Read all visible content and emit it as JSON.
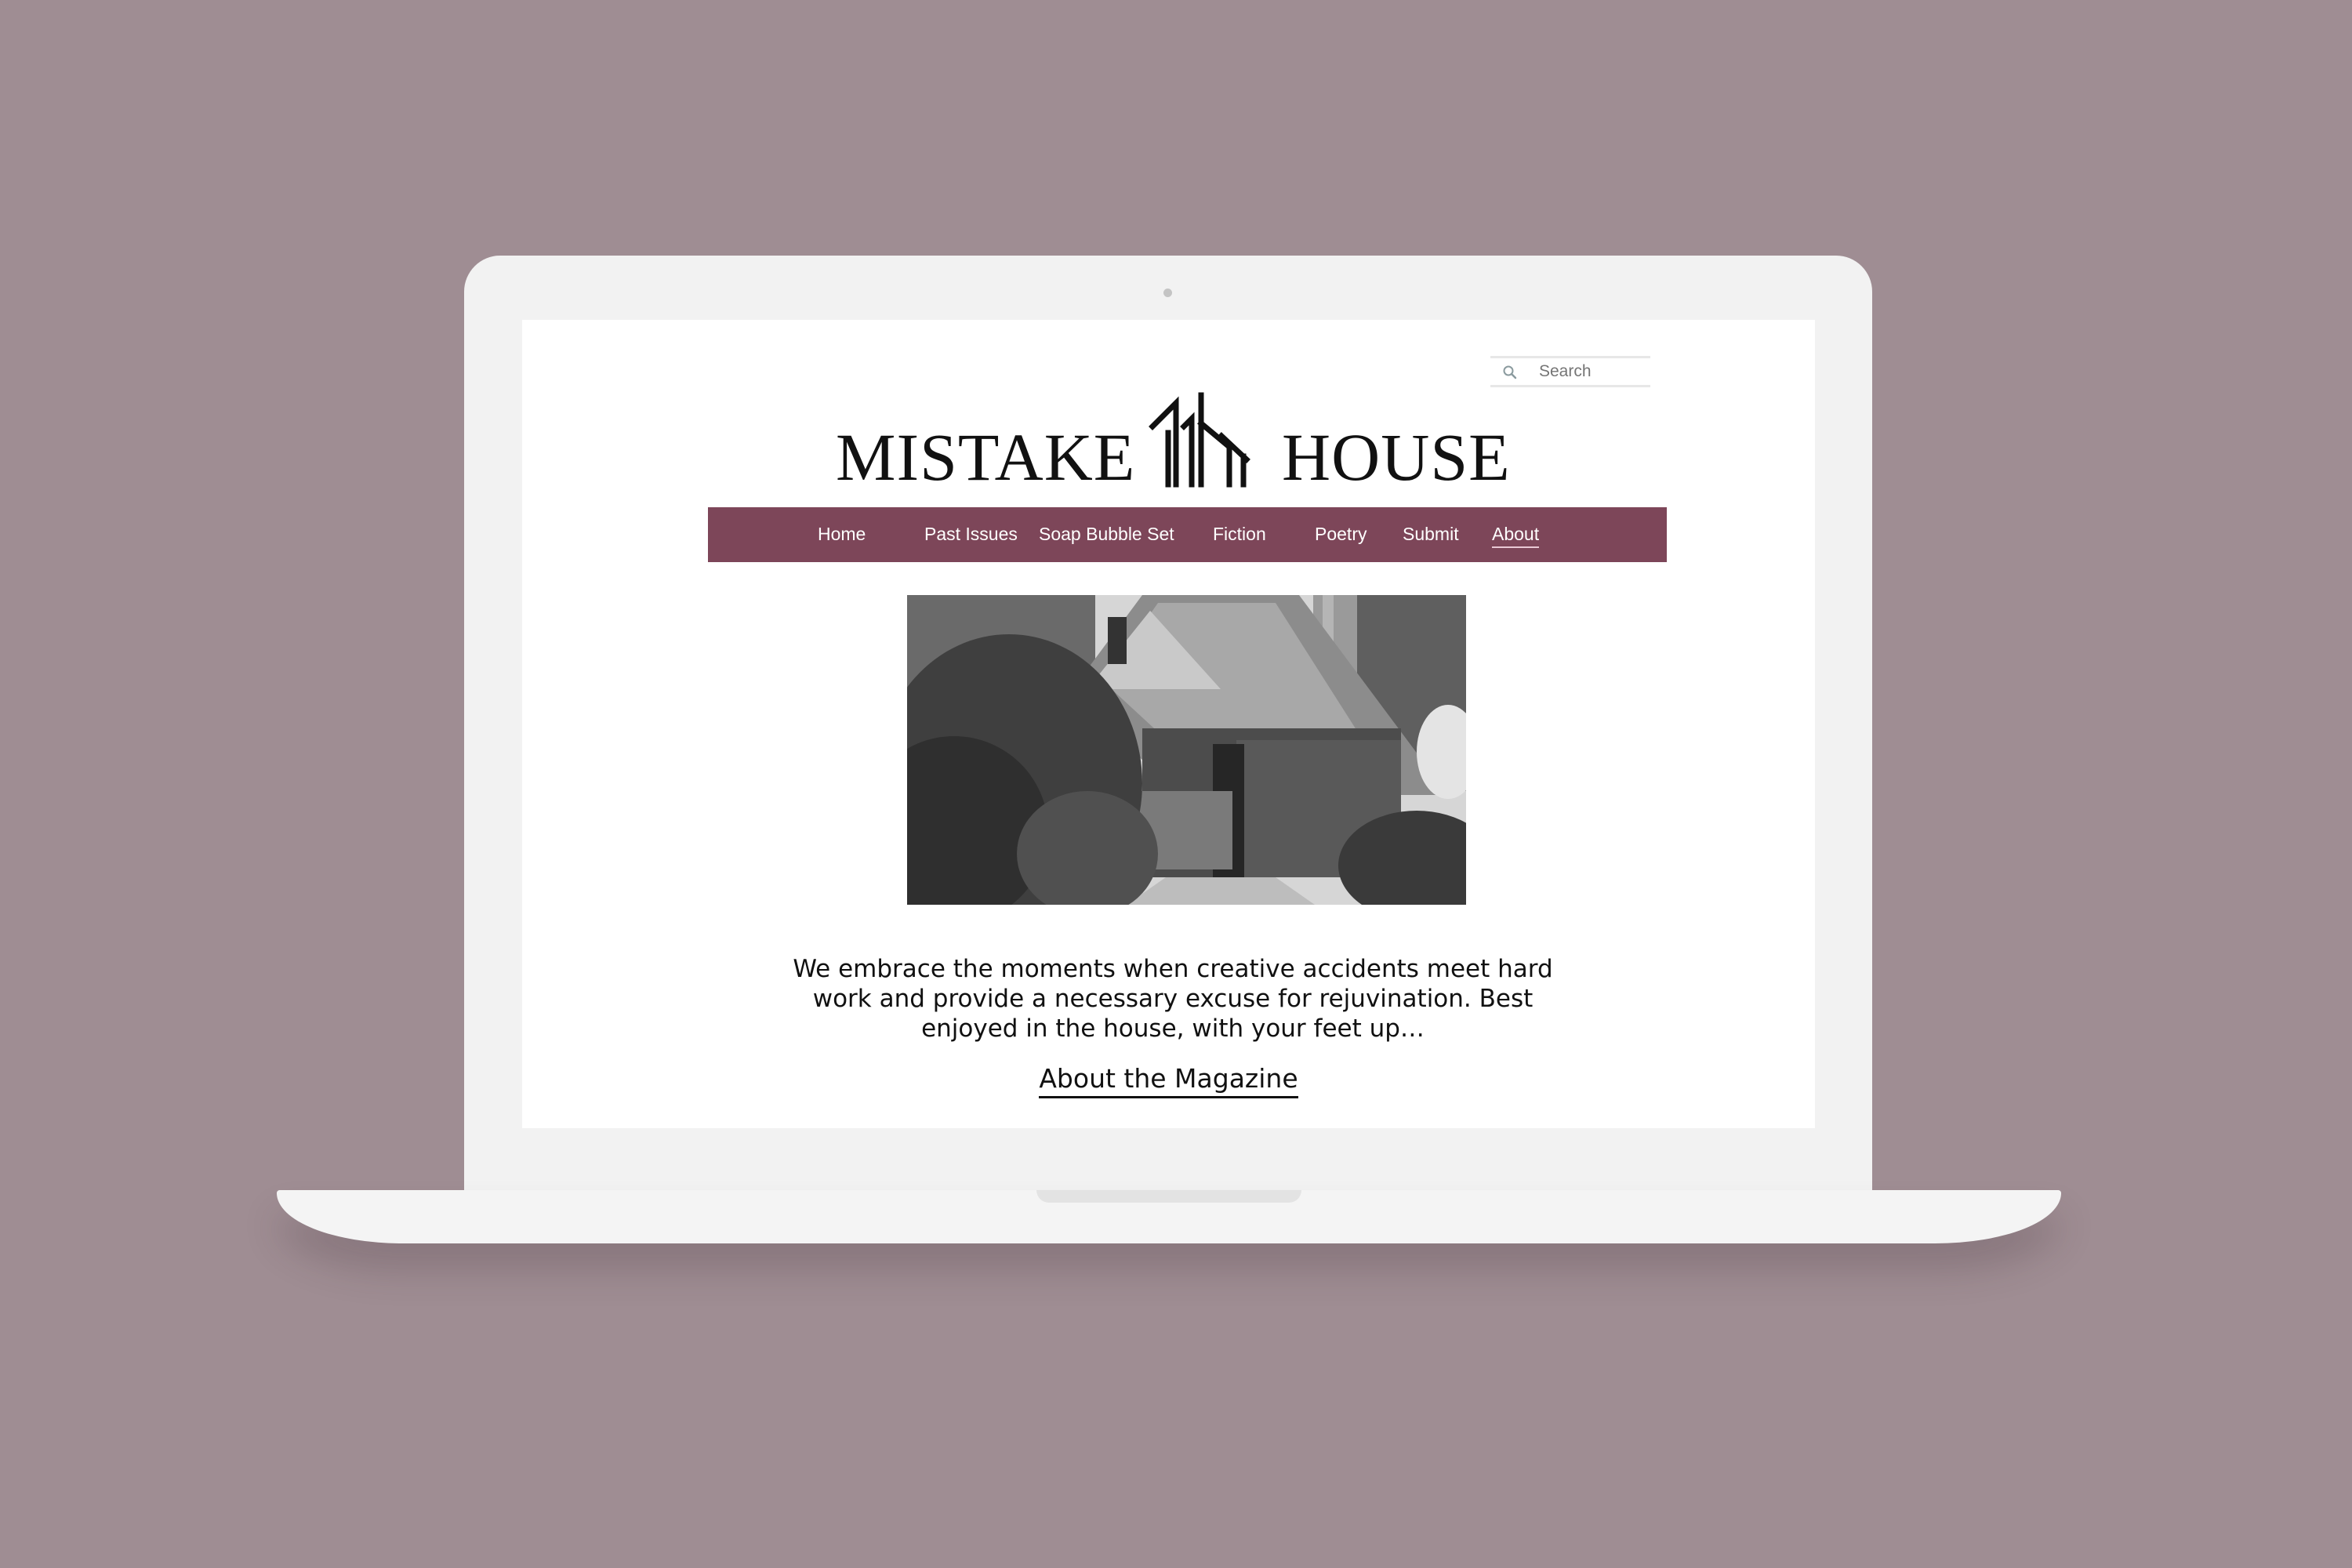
{
  "search": {
    "placeholder": "Search",
    "icon": "search-icon"
  },
  "brand": {
    "word_left": "MISTAKE",
    "word_right": "HOUSE",
    "logo_mark": "house-icon"
  },
  "nav": {
    "items": [
      {
        "label": "Home",
        "active": false
      },
      {
        "label": "Past Issues",
        "active": false
      },
      {
        "label": "Soap Bubble Set",
        "active": false
      },
      {
        "label": "Fiction",
        "active": false
      },
      {
        "label": "Poetry",
        "active": false
      },
      {
        "label": "Submit",
        "active": false
      },
      {
        "label": "About",
        "active": true
      }
    ]
  },
  "hero": {
    "tagline": "We embrace the moments when creative accidents meet hard work and provide a necessary excuse for rejuvination. Best enjoyed in the house, with your feet up…",
    "cta_label": "About the Magazine"
  },
  "colors": {
    "background": "#9f8d93",
    "nav_bar": "#7d4659",
    "text": "#111111"
  }
}
